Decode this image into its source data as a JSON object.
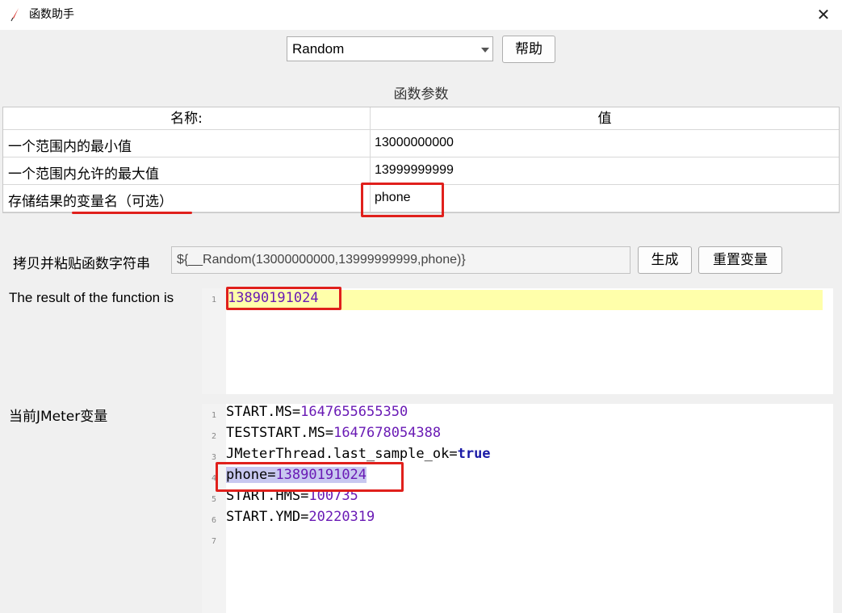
{
  "window": {
    "title": "函数助手",
    "close_symbol": "✕"
  },
  "function_select": {
    "value": "Random"
  },
  "buttons": {
    "help": "帮助",
    "generate": "生成",
    "reset_vars": "重置变量"
  },
  "params": {
    "section_title": "函数参数",
    "headers": {
      "name": "名称:",
      "value": "值"
    },
    "rows": [
      {
        "name": "一个范围内的最小值",
        "value": "13000000000"
      },
      {
        "name": "一个范围内允许的最大值",
        "value": "13999999999"
      },
      {
        "name": "存储结果的变量名（可选）",
        "value": "phone"
      }
    ]
  },
  "copy": {
    "label": "拷贝并粘贴函数字符串",
    "value": "${__Random(13000000000,13999999999,phone)}"
  },
  "result": {
    "label": "The result of the function is",
    "line_number": "1",
    "value": "13890191024"
  },
  "jmeter_vars": {
    "label": "当前JMeter变量",
    "lines": [
      {
        "num": "1",
        "key": "START.MS",
        "eq": "=",
        "val": "1647655655350"
      },
      {
        "num": "2",
        "key": "TESTSTART.MS",
        "eq": "=",
        "val": "1647678054388"
      },
      {
        "num": "3",
        "key": "JMeterThread.last_sample_ok",
        "eq": "=",
        "val": "true"
      },
      {
        "num": "4",
        "key": "phone",
        "eq": "=",
        "val": "13890191024"
      },
      {
        "num": "5",
        "key": "START.HMS",
        "eq": "=",
        "val": "100735"
      },
      {
        "num": "6",
        "key": "START.YMD",
        "eq": "=",
        "val": "20220319"
      },
      {
        "num": "7",
        "key": "",
        "eq": "",
        "val": ""
      }
    ]
  },
  "colors": {
    "annotation_red": "#e0201c",
    "number_purple": "#6a1bb5",
    "highlight_yellow": "#ffffaa"
  }
}
